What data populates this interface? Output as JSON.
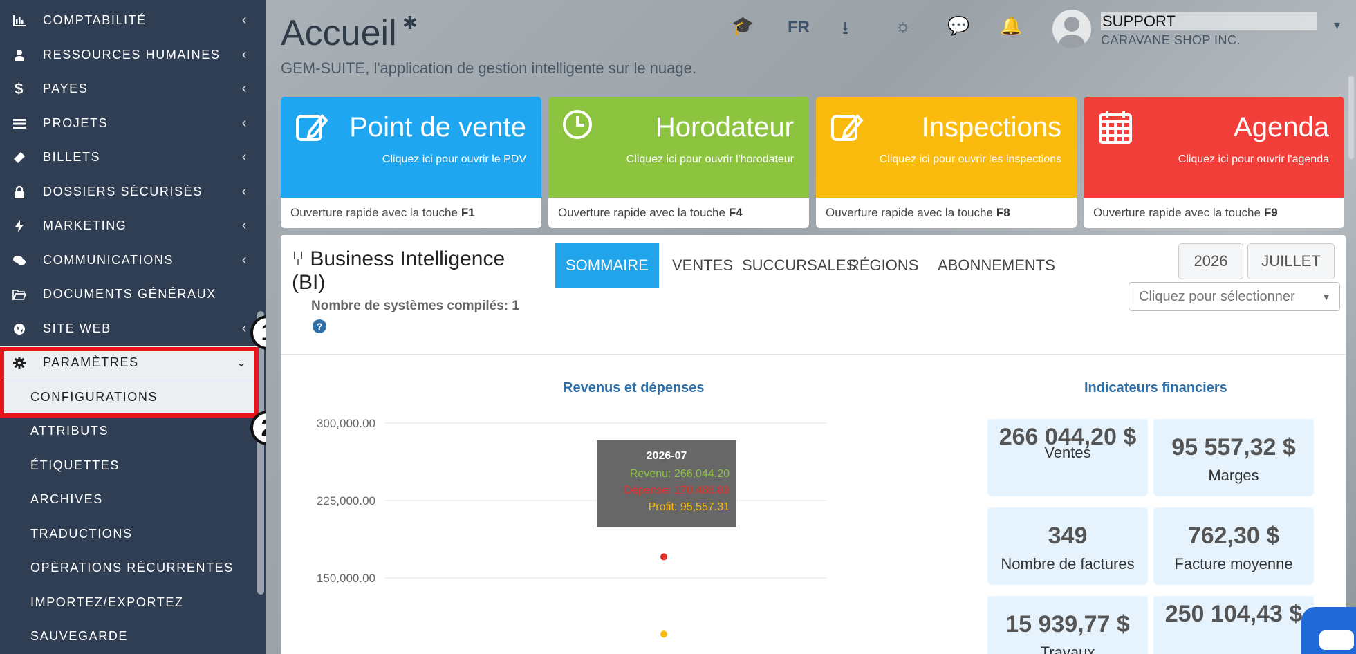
{
  "sidebar": {
    "items": [
      {
        "label": "COMPTABILITÉ",
        "icon": "bar-chart-icon",
        "arrow": "‹"
      },
      {
        "label": "RESSOURCES HUMAINES",
        "icon": "user-icon",
        "arrow": "‹"
      },
      {
        "label": "PAYES",
        "icon": "dollar-icon",
        "arrow": "‹"
      },
      {
        "label": "PROJETS",
        "icon": "tasks-icon",
        "arrow": "‹"
      },
      {
        "label": "BILLETS",
        "icon": "ticket-icon",
        "arrow": "‹"
      },
      {
        "label": "DOSSIERS SÉCURISÉS",
        "icon": "lock-icon",
        "arrow": "‹"
      },
      {
        "label": "MARKETING",
        "icon": "bolt-icon",
        "arrow": "‹"
      },
      {
        "label": "COMMUNICATIONS",
        "icon": "comments-icon",
        "arrow": "‹"
      },
      {
        "label": "DOCUMENTS GÉNÉRAUX",
        "icon": "folder-open-icon",
        "arrow": ""
      },
      {
        "label": "SITE WEB",
        "icon": "globe-icon",
        "arrow": "‹"
      },
      {
        "label": "PARAMÈTRES",
        "icon": "gear-icon",
        "arrow": "⌄"
      }
    ],
    "subitems": [
      "CONFIGURATIONS",
      "ATTRIBUTS",
      "ÉTIQUETTES",
      "ARCHIVES",
      "TRADUCTIONS",
      "OPÉRATIONS RÉCURRENTES",
      "IMPORTEZ/EXPORTEZ",
      "SAUVEGARDE"
    ]
  },
  "annotations": {
    "badge1": "1",
    "badge2": "2",
    "highlight_color": "#e8141c"
  },
  "header": {
    "title": "Accueil",
    "subtitle": "GEM-SUITE, l'application de gestion intelligente sur le nuage.",
    "lang": "FR",
    "user_name": "SUPPORT",
    "user_company": "CARAVANE SHOP INC."
  },
  "tiles": [
    {
      "name": "Point de vente",
      "sub": "Cliquez ici pour ouvrir le PDV",
      "footer": "Ouverture rapide avec la touche",
      "key": "F1",
      "color": "#1ea7f0",
      "icon": "edit-icon"
    },
    {
      "name": "Horodateur",
      "sub": "Cliquez ici pour ouvrir l'horodateur",
      "footer": "Ouverture rapide avec la touche",
      "key": "F4",
      "color": "#8cc440",
      "icon": "clock-icon"
    },
    {
      "name": "Inspections",
      "sub": "Cliquez ici pour ouvrir les inspections",
      "footer": "Ouverture rapide avec la touche",
      "key": "F8",
      "color": "#fbbb0e",
      "icon": "edit-icon"
    },
    {
      "name": "Agenda",
      "sub": "Cliquez ici pour ouvrir l'agenda",
      "footer": "Ouverture rapide avec la touche",
      "key": "F9",
      "color": "#f13e39",
      "icon": "calendar-icon"
    }
  ],
  "bi": {
    "title": "Business Intelligence (BI)",
    "systems": "Nombre de systèmes compilés: 1",
    "help": "?",
    "tabs": [
      "SOMMAIRE",
      "VENTES",
      "SUCCURSALES",
      "RÉGIONS",
      "ABONNEMENTS"
    ],
    "year": "2026",
    "month": "JUILLET",
    "select_placeholder": "Cliquez pour sélectionner"
  },
  "chart_data": {
    "type": "scatter",
    "title": "Revenus et dépenses",
    "y_ticks": [
      "300,000.00",
      "225,000.00",
      "150,000.00"
    ],
    "ylim": [
      150000,
      300000
    ],
    "series": [
      {
        "name": "Revenu",
        "color": "#8cc440",
        "points": [
          {
            "x": "2026-07",
            "y": 266044.2
          }
        ]
      },
      {
        "name": "Dépense",
        "color": "#e0302a",
        "points": [
          {
            "x": "2026-07",
            "y": 170486.89
          }
        ]
      },
      {
        "name": "Profit",
        "color": "#fbbb0e",
        "points": [
          {
            "x": "2026-07",
            "y": 95557.31
          }
        ]
      }
    ],
    "tooltip": {
      "title": "2026-07",
      "lines": [
        "Revenu: 266,044.20",
        "Dépense: 170,486.89",
        "Profit: 95,557.31"
      ]
    }
  },
  "kpis": {
    "title": "Indicateurs financiers",
    "items": [
      {
        "value": "266 044,20 $",
        "label": "Ventes"
      },
      {
        "value": "95 557,32 $",
        "label": "Marges"
      },
      {
        "value": "349",
        "label": "Nombre de factures"
      },
      {
        "value": "762,30 $",
        "label": "Facture moyenne"
      },
      {
        "value": "15 939,77 $",
        "label": "Travaux"
      },
      {
        "value": "250 104,43 $",
        "label": ""
      }
    ]
  }
}
